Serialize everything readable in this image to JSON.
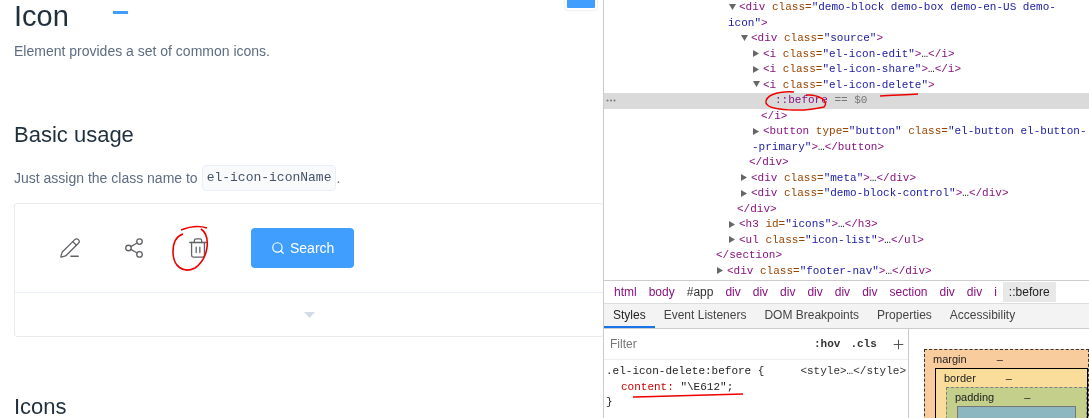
{
  "page": {
    "title": "Icon",
    "intro": "Element provides a set of common icons.",
    "section_title": "Basic usage",
    "usage_text": "Just assign the class name to",
    "usage_code": "el-icon-iconName",
    "usage_end": ".",
    "demo": {
      "icons": [
        {
          "kind": "edit"
        },
        {
          "kind": "share"
        },
        {
          "kind": "delete"
        }
      ],
      "button": {
        "label": "Search"
      }
    },
    "next_heading": "Icons"
  },
  "devtools": {
    "dom_tree": [
      {
        "close": "</section>",
        "children": [
          {
            "text": "<div class=\"demo-block demo-box demo-en-US demo-icon\">",
            "expanded": true,
            "close": "</div>",
            "children": [
              {
                "text": "<div class=\"source\">",
                "expanded": true,
                "close": "</div>",
                "children": [
                  {
                    "text": "<i class=\"el-icon-edit\">…</i>",
                    "expanded": false
                  },
                  {
                    "text": "<i class=\"el-icon-share\">…</i>",
                    "expanded": false
                  },
                  {
                    "text": "<i class=\"el-icon-delete\">",
                    "expanded": true,
                    "close": "</i>",
                    "children": [
                      {
                        "text": "::before == $0",
                        "selected": true
                      }
                    ]
                  },
                  {
                    "text": "<button type=\"button\" class=\"el-button el-button--primary\">…</button>",
                    "expanded": false
                  }
                ]
              },
              {
                "text": "<div class=\"meta\">…</div>",
                "expanded": false
              },
              {
                "text": "<div class=\"demo-block-control\">…</div>",
                "expanded": false
              }
            ]
          },
          {
            "text": "<h3 id=\"icons\">…</h3>",
            "expanded": false
          },
          {
            "text": "<ul class=\"icon-list\">…</ul>",
            "expanded": false
          }
        ]
      },
      {
        "text": "<div class=\"footer-nav\">…</div>",
        "expanded": false
      }
    ],
    "breadcrumbs": [
      {
        "label": "html",
        "kind": "tag",
        "selected": false
      },
      {
        "label": "body",
        "kind": "tag",
        "selected": false
      },
      {
        "label": "#app",
        "kind": "id",
        "selected": false
      },
      {
        "label": "div",
        "kind": "tag",
        "selected": false
      },
      {
        "label": "div",
        "kind": "tag",
        "selected": false
      },
      {
        "label": "div",
        "kind": "tag",
        "selected": false
      },
      {
        "label": "div",
        "kind": "tag",
        "selected": false
      },
      {
        "label": "div",
        "kind": "tag",
        "selected": false
      },
      {
        "label": "div",
        "kind": "tag",
        "selected": false
      },
      {
        "label": "section",
        "kind": "tag",
        "selected": false
      },
      {
        "label": "div",
        "kind": "tag",
        "selected": false
      },
      {
        "label": "div",
        "kind": "tag",
        "selected": false
      },
      {
        "label": "i",
        "kind": "tag",
        "selected": false
      },
      {
        "label": "::before",
        "kind": "pseudo",
        "selected": true
      }
    ],
    "tabs": [
      {
        "label": "Styles",
        "selected": true
      },
      {
        "label": "Event Listeners",
        "selected": false
      },
      {
        "label": "DOM Breakpoints",
        "selected": false
      },
      {
        "label": "Properties",
        "selected": false
      },
      {
        "label": "Accessibility",
        "selected": false
      }
    ],
    "filter": {
      "placeholder": "Filter"
    },
    "toggles": [
      ":hov",
      ".cls"
    ],
    "rule": {
      "selector": ".el-icon-delete:before {",
      "source": "<style>…</style>",
      "declarations": [
        {
          "property": "content:",
          "value": "\"\\E612\";"
        }
      ],
      "close": "}"
    },
    "box_model": [
      {
        "label": "margin",
        "value": "–"
      },
      {
        "label": "border",
        "value": "–"
      },
      {
        "label": "padding",
        "value": "–"
      }
    ]
  }
}
